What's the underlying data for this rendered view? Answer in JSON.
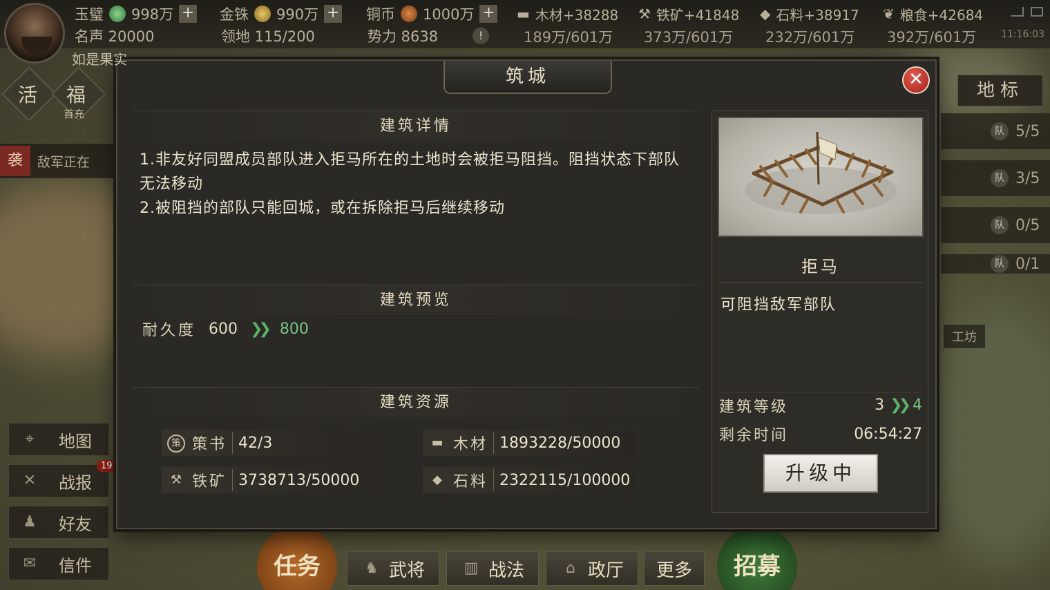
{
  "topbar": {
    "jade": {
      "label": "玉璧",
      "value": "998万",
      "plus": "+"
    },
    "gold": {
      "label": "金铢",
      "value": "990万",
      "plus": "+"
    },
    "copper": {
      "label": "铜币",
      "value": "1000万",
      "plus": "+"
    },
    "wood": {
      "rate": "木材+38288",
      "cap": "189万/601万"
    },
    "iron": {
      "rate": "铁矿+41848",
      "cap": "373万/601万"
    },
    "stone": {
      "rate": "石料+38917",
      "cap": "232万/601万"
    },
    "grain": {
      "rate": "粮食+42684",
      "cap": "392万/601万"
    },
    "fame": "名声 20000",
    "territory": "领地 115/200",
    "power": "势力 8638",
    "alert": "!",
    "clock": "11:16:03",
    "player_name": "如是果实"
  },
  "left_widgets": {
    "huo": "活",
    "fu": "福",
    "fu_sub": "首充",
    "enemy_tag": "袭",
    "enemy_text": "敌军正在",
    "buttons": [
      {
        "label": "地图",
        "icon": "map-icon"
      },
      {
        "label": "战报",
        "icon": "swords-icon"
      },
      {
        "label": "好友",
        "icon": "friends-icon"
      },
      {
        "label": "信件",
        "icon": "mail-icon"
      }
    ],
    "battle_badge": "19"
  },
  "right_widgets": {
    "landmark": "地标",
    "queues": [
      {
        "icon": "队",
        "value": "5/5"
      },
      {
        "icon": "队",
        "value": "3/5"
      },
      {
        "icon": "队",
        "value": "0/5"
      },
      {
        "icon": "队",
        "value": "0/1"
      }
    ],
    "workshop": "工坊"
  },
  "bottom": {
    "task": "任务",
    "recruit": "招募",
    "tabs": [
      {
        "label": "武将",
        "icon": "general-icon"
      },
      {
        "label": "战法",
        "icon": "tactics-icon"
      },
      {
        "label": "政厅",
        "icon": "hall-icon"
      },
      {
        "label": "更多",
        "icon": ""
      }
    ]
  },
  "modal": {
    "title": "筑城",
    "close": "✕",
    "sections": {
      "detail": "建筑详情",
      "preview": "建筑预览",
      "resources": "建筑资源"
    },
    "detail_line1": "1.非友好同盟成员部队进入拒马所在的土地时会被拒马阻挡。阻挡状态下部队无法移动",
    "detail_line2": "2.被阻挡的部队只能回城，或在拆除拒马后继续移动",
    "durability": {
      "label": "耐久度",
      "from": "600",
      "to": "800"
    },
    "resources": [
      {
        "icon": "策",
        "name": "策书",
        "value": "42/3"
      },
      {
        "icon": "▬",
        "name": "木材",
        "value": "1893228/50000"
      },
      {
        "icon": "⚒",
        "name": "铁矿",
        "value": "3738713/50000"
      },
      {
        "icon": "◆",
        "name": "石料",
        "value": "2322115/100000"
      }
    ],
    "building": {
      "name": "拒马",
      "desc": "可阻挡敌军部队",
      "level_label": "建筑等级",
      "level_from": "3",
      "level_to": "4",
      "time_label": "剩余时间",
      "time_value": "06:54:27",
      "upgrade_button": "升级中"
    }
  },
  "colors": {
    "accent_green": "#79c381",
    "close_red": "#c23a30",
    "panel_bg": "#2b2925"
  }
}
